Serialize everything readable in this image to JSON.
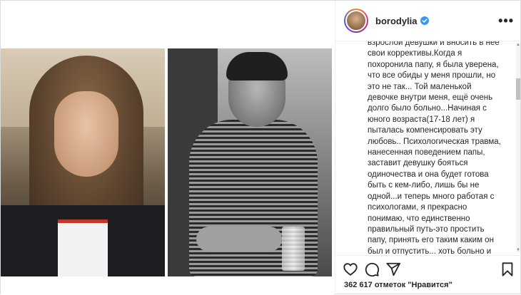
{
  "post": {
    "username": "borodylia",
    "verified": true,
    "more_label": "•••",
    "caption": "взрослой девушки и вносить в нее\nсвои коррективы.Когда я\nпохоронила папу, я была уверена,\nчто все обиды у меня прошли, но\nэто не так... Той маленькой\nдевочке внутри меня, ещё очень\nдолго было больно...Начиная с\nюного возраста(17-18 лет) я\nпыталась компенсировать эту\nлюбовь.. Психологическая травма,\nнанесенная поведением папы,\nзаставит девушку бояться\nодиночества и она будет готова\nбыть с кем-либо, лишь бы не\nодной...и теперь много работая с\nпсихологами, я прекрасно\nпонимаю, что единственно\nправильный путь-это простить\nпапу, принять его таким каким он\nбыл и отпустить... хоть больно и\nтяжело, но это надо сделать,",
    "likes_text": "362 617 отметок \"Нравится\""
  },
  "icons": {
    "verified": "verified-badge-icon",
    "like": "heart-icon",
    "comment": "comment-icon",
    "share": "paper-plane-icon",
    "save": "bookmark-icon",
    "more": "more-options-icon"
  },
  "colors": {
    "verified": "#3897f0",
    "text": "#262626",
    "border": "#dbdbdb"
  }
}
